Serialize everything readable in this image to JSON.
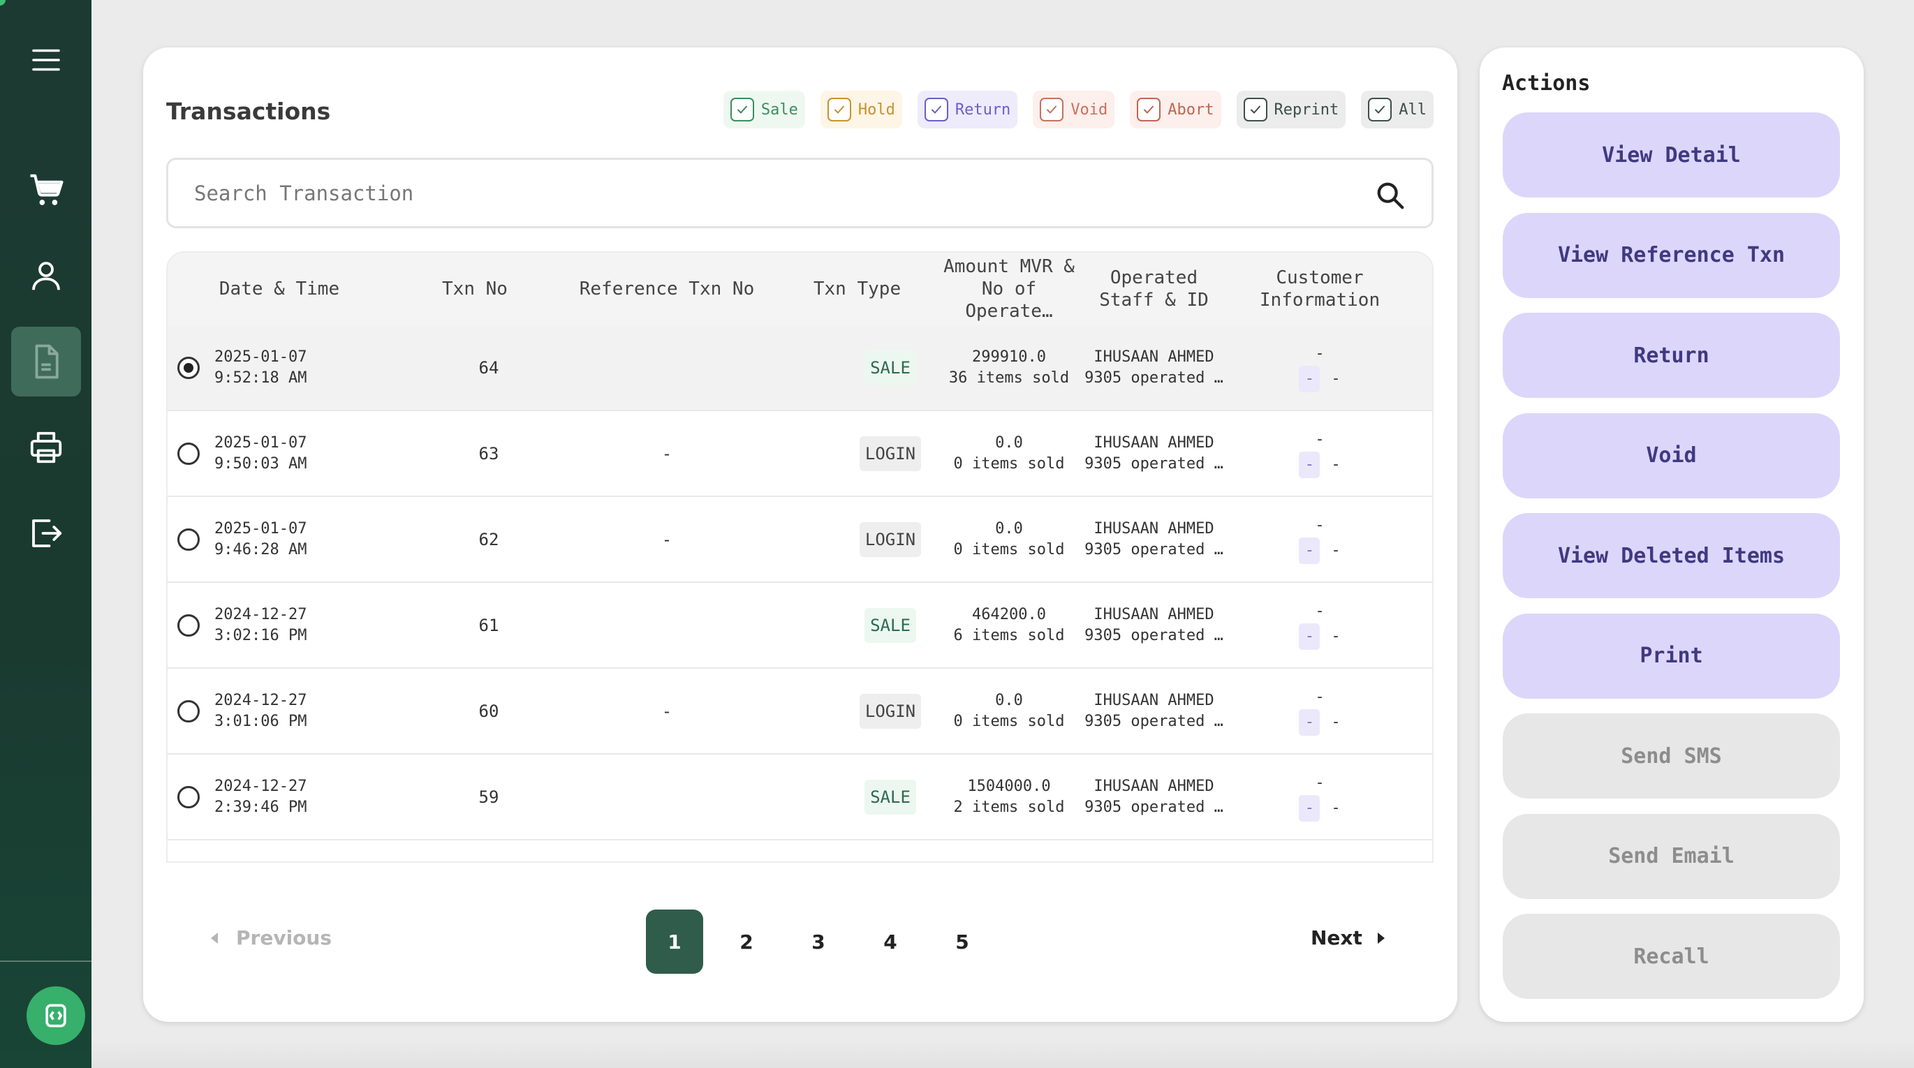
{
  "sidebar": {
    "icons": [
      "menu-icon",
      "cart-icon",
      "user-icon",
      "document-icon",
      "printer-icon",
      "logout-icon",
      "support-icon"
    ],
    "active": "document-icon",
    "colors": {
      "bg": "#1c3a31",
      "active": "#3f6b5b",
      "badge": "#36b06b"
    }
  },
  "transactions": {
    "title": "Transactions",
    "filters": [
      {
        "label": "Sale",
        "color": "#3a8f5c",
        "bg": "#eef8f0"
      },
      {
        "label": "Hold",
        "color": "#c9922b",
        "bg": "#fdf5e6"
      },
      {
        "label": "Return",
        "color": "#6a5fc9",
        "bg": "#eeebfb"
      },
      {
        "label": "Void",
        "color": "#c9705a",
        "bg": "#fcefec"
      },
      {
        "label": "Abort",
        "color": "#c0654f",
        "bg": "#fcefec"
      },
      {
        "label": "Reprint",
        "color": "#3d4f4a",
        "bg": "#ececec"
      },
      {
        "label": "All",
        "color": "#3d4f4a",
        "bg": "#ececec"
      }
    ],
    "search_placeholder": "Search Transaction",
    "columns": {
      "date": "Date & Time",
      "txn_no": "Txn No",
      "ref": "Reference Txn No",
      "type": "Txn Type",
      "amount": "Amount MVR & No of Operate…",
      "staff": "Operated Staff & ID",
      "customer": "Customer Information"
    },
    "rows": [
      {
        "date": "2025-01-07",
        "time": "9:52:18 AM",
        "txn": "64",
        "ref": "",
        "type": "SALE",
        "amount": "299910.0",
        "items": "36 items sold",
        "staff": "IHUSAAN AHMED",
        "staff_id": "9305 operated …",
        "cust1": "-",
        "cust_pill": "-",
        "cust2": "-",
        "selected": true
      },
      {
        "date": "2025-01-07",
        "time": "9:50:03 AM",
        "txn": "63",
        "ref": "-",
        "type": "LOGIN",
        "amount": "0.0",
        "items": "0 items sold",
        "staff": "IHUSAAN AHMED",
        "staff_id": "9305 operated …",
        "cust1": "-",
        "cust_pill": "-",
        "cust2": "-",
        "selected": false
      },
      {
        "date": "2025-01-07",
        "time": "9:46:28 AM",
        "txn": "62",
        "ref": "-",
        "type": "LOGIN",
        "amount": "0.0",
        "items": "0 items sold",
        "staff": "IHUSAAN AHMED",
        "staff_id": "9305 operated …",
        "cust1": "-",
        "cust_pill": "-",
        "cust2": "-",
        "selected": false
      },
      {
        "date": "2024-12-27",
        "time": "3:02:16 PM",
        "txn": "61",
        "ref": "",
        "type": "SALE",
        "amount": "464200.0",
        "items": "6 items sold",
        "staff": "IHUSAAN AHMED",
        "staff_id": "9305 operated …",
        "cust1": "-",
        "cust_pill": "-",
        "cust2": "-",
        "selected": false
      },
      {
        "date": "2024-12-27",
        "time": "3:01:06 PM",
        "txn": "60",
        "ref": "-",
        "type": "LOGIN",
        "amount": "0.0",
        "items": "0 items sold",
        "staff": "IHUSAAN AHMED",
        "staff_id": "9305 operated …",
        "cust1": "-",
        "cust_pill": "-",
        "cust2": "-",
        "selected": false
      },
      {
        "date": "2024-12-27",
        "time": "2:39:46 PM",
        "txn": "59",
        "ref": "",
        "type": "SALE",
        "amount": "1504000.0",
        "items": "2 items sold",
        "staff": "IHUSAAN AHMED",
        "staff_id": "9305 operated …",
        "cust1": "-",
        "cust_pill": "-",
        "cust2": "-",
        "selected": false
      }
    ],
    "pagination": {
      "previous": "Previous",
      "next": "Next",
      "pages": [
        "1",
        "2",
        "3",
        "4",
        "5"
      ],
      "current": "1"
    }
  },
  "actions": {
    "title": "Actions",
    "buttons": [
      {
        "label": "View Detail",
        "enabled": true
      },
      {
        "label": "View Reference Txn",
        "enabled": true
      },
      {
        "label": "Return",
        "enabled": true
      },
      {
        "label": "Void",
        "enabled": true
      },
      {
        "label": "View Deleted Items",
        "enabled": true
      },
      {
        "label": "Print",
        "enabled": true
      },
      {
        "label": "Send SMS",
        "enabled": false
      },
      {
        "label": "Send Email",
        "enabled": false
      },
      {
        "label": "Recall",
        "enabled": false
      }
    ]
  }
}
